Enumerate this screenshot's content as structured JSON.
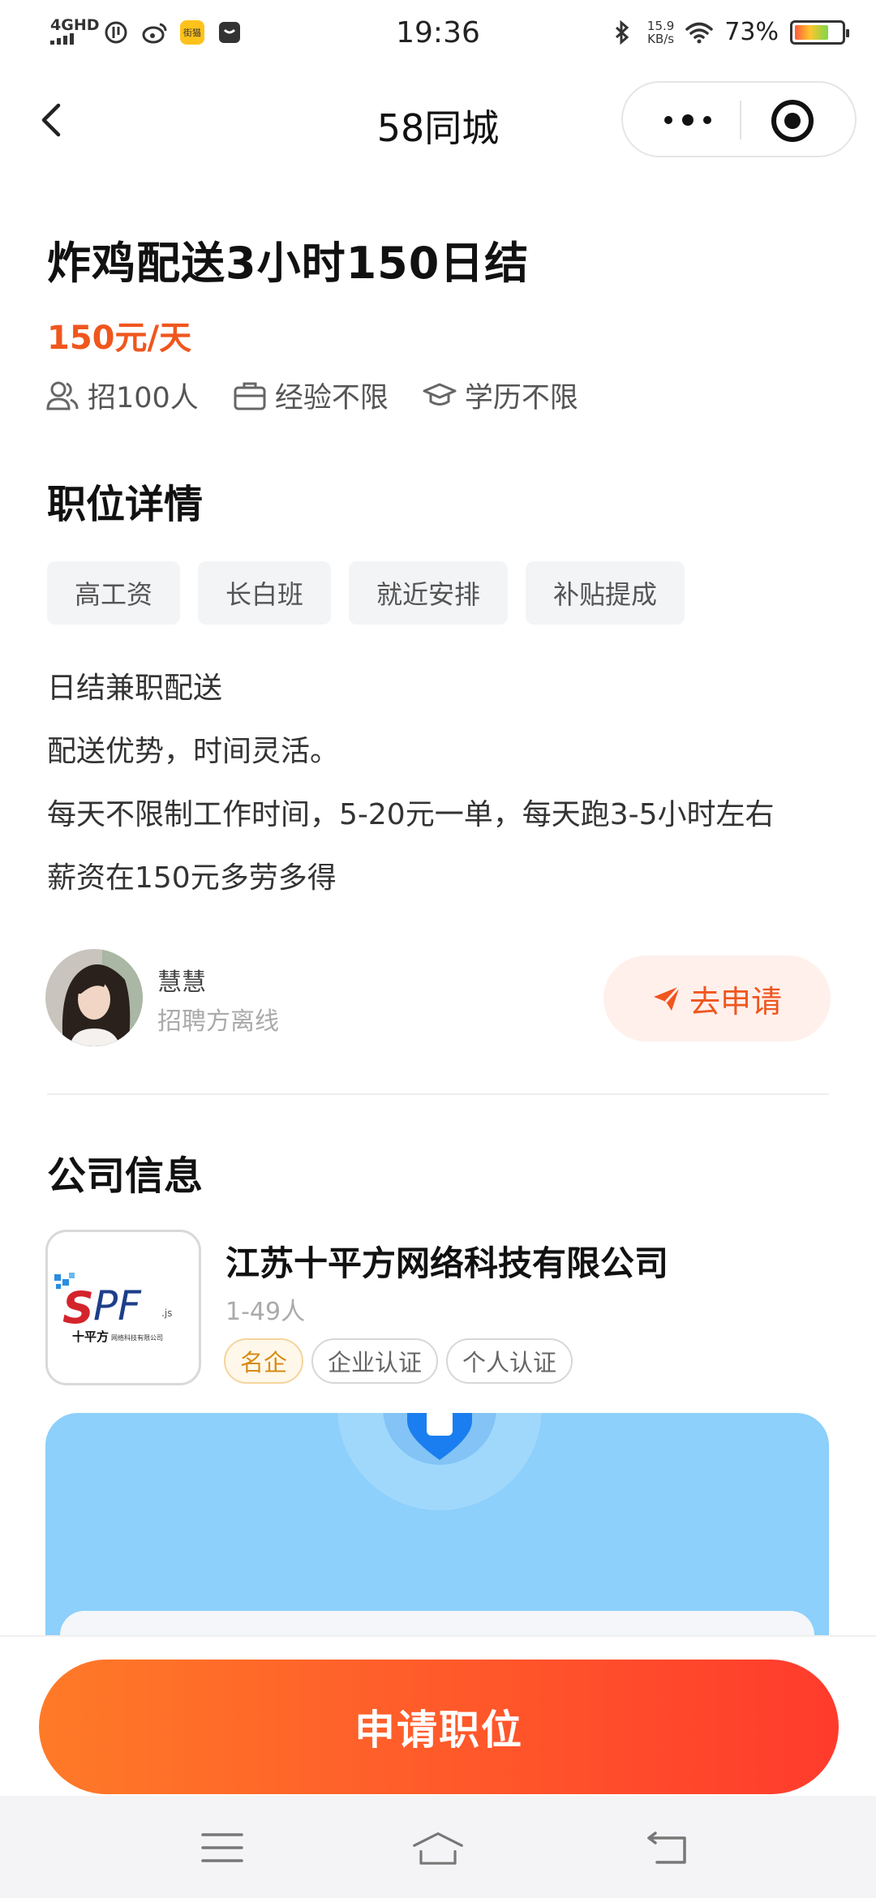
{
  "status_bar": {
    "network": "4GHD",
    "app_badge": "街猫",
    "time": "19:36",
    "speed_value": "15.9",
    "speed_unit": "KB/s",
    "battery": "73%"
  },
  "nav": {
    "title": "58同城"
  },
  "job": {
    "title": "炸鸡配送3小时150日结",
    "salary": "150元/天",
    "meta": {
      "headcount": "招100人",
      "experience": "经验不限",
      "education": "学历不限"
    }
  },
  "details": {
    "section_title": "职位详情",
    "tags": [
      "高工资",
      "长白班",
      "就近安排",
      "补贴提成"
    ],
    "description": [
      "日结兼职配送",
      "配送优势，时间灵活。",
      "每天不限制工作时间，5-20元一单，每天跑3-5小时左右",
      "薪资在150元多劳多得"
    ]
  },
  "recruiter": {
    "name": "慧慧",
    "status": "招聘方离线",
    "apply_label": "去申请"
  },
  "company": {
    "section_title": "公司信息",
    "name": "江苏十平方网络科技有限公司",
    "size": "1-49人",
    "badges": [
      "名企",
      "企业认证",
      "个人认证"
    ],
    "logo_text": "SPF",
    "logo_suffix": ".js",
    "logo_subtitle": "十平方",
    "logo_subtitle_small": "网络科技有限公司"
  },
  "bottom": {
    "apply_button": "申请职位"
  },
  "colors": {
    "accent": "#f0561e",
    "button_start": "#ff7a28",
    "button_end": "#ff3b2c",
    "map_blue": "#8cd0fb",
    "badge_gold": "#d68b16"
  },
  "icons": [
    "back-icon",
    "more-icon",
    "target-icon",
    "people-icon",
    "briefcase-icon",
    "graduation-icon",
    "send-icon",
    "menu-icon",
    "home-icon",
    "return-icon",
    "location-pin-icon"
  ]
}
